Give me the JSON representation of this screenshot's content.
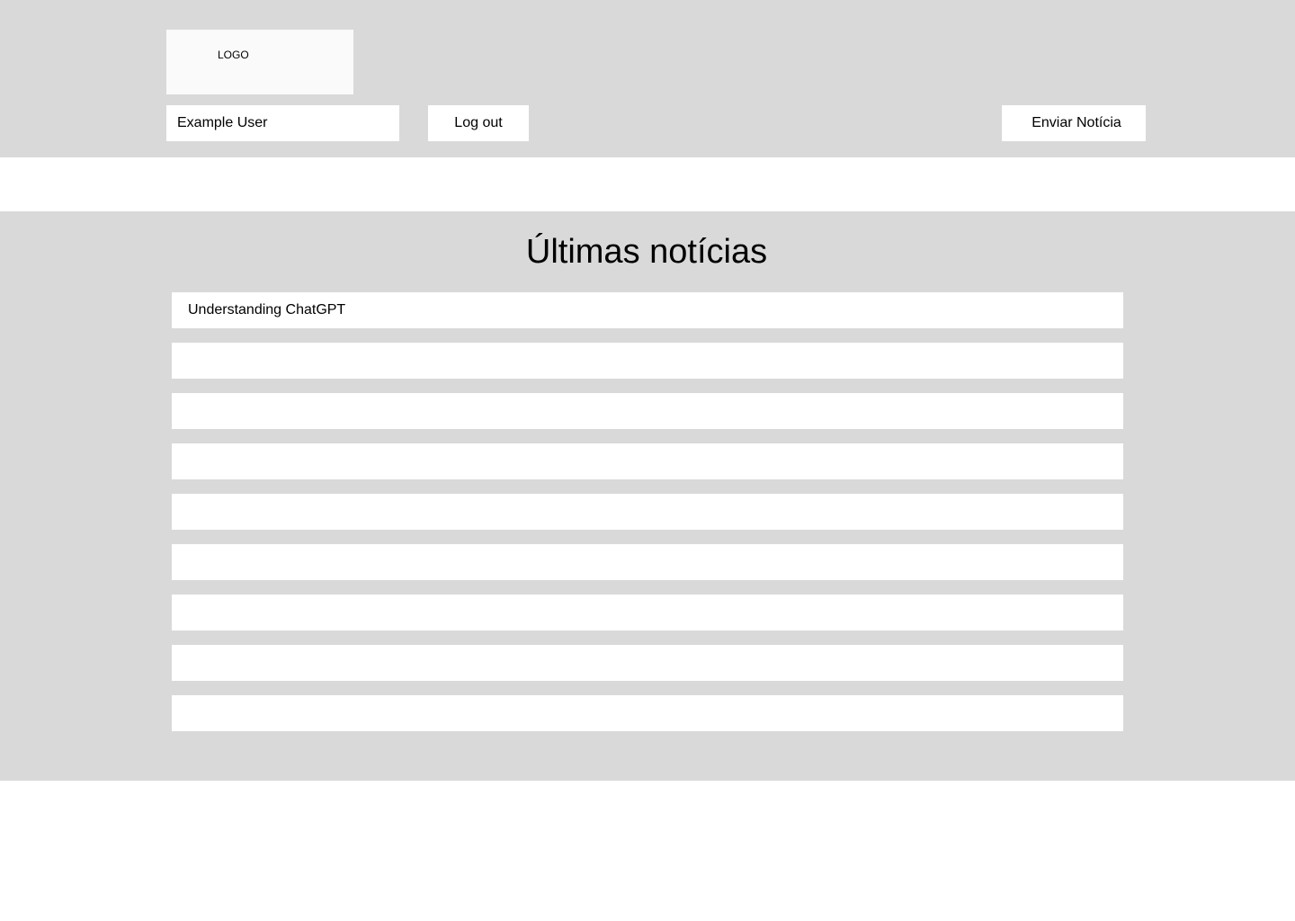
{
  "header": {
    "logo_label": "LOGO",
    "user_name": "Example User",
    "logout_label": "Log out",
    "send_news_label": "Enviar Notícia"
  },
  "news": {
    "title": "Últimas notícias",
    "items": [
      {
        "label": "Understanding ChatGPT"
      },
      {
        "label": ""
      },
      {
        "label": ""
      },
      {
        "label": ""
      },
      {
        "label": ""
      },
      {
        "label": ""
      },
      {
        "label": ""
      },
      {
        "label": ""
      },
      {
        "label": ""
      }
    ]
  },
  "colors": {
    "panel_background": "#d9d9d9",
    "field_background": "#ffffff",
    "logo_background": "#fafafa",
    "text": "#000000"
  }
}
